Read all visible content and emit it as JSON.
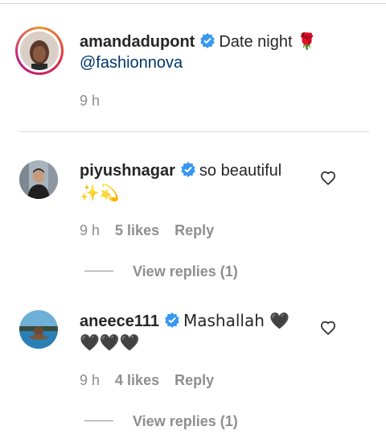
{
  "caption": {
    "username": "amandadupont",
    "text": "Date night",
    "text_emoji": "🌹",
    "mention": "@fashionnova",
    "time": "9 h"
  },
  "comments": [
    {
      "username": "piyushnagar",
      "text": "so beautiful",
      "emoji_line": "✨💫",
      "time": "9 h",
      "likes": "5 likes",
      "reply": "Reply",
      "view_replies": "View replies (1)"
    },
    {
      "username": "aneece111",
      "text": "Mashallah 🖤",
      "emoji_line": "🖤🖤🖤",
      "time": "9 h",
      "likes": "4 likes",
      "reply": "Reply",
      "view_replies": "View replies (1)"
    }
  ],
  "colors": {
    "verified": "#3897f0",
    "mention": "#00376b",
    "meta": "#8e8e8e",
    "story_ring": [
      "#f09433",
      "#dc2743",
      "#bc1888"
    ]
  },
  "icons": [
    "verified-badge-icon",
    "heart-icon"
  ]
}
